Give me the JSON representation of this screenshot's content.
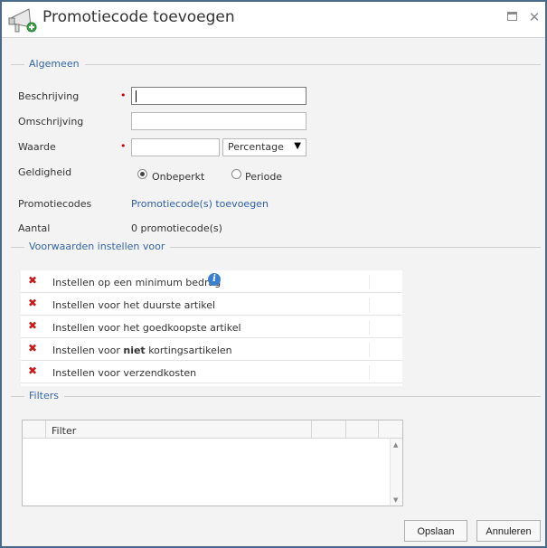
{
  "window": {
    "title": "Promotiecode toevoegen",
    "maximize_icon": "maximize-icon",
    "close_icon": "close-icon",
    "close_glyph": "✕"
  },
  "sections": {
    "general": "Algemeen",
    "conditions": "Voorwaarden instellen voor",
    "filters": "Filters"
  },
  "form": {
    "description_label": "Beschrijving",
    "description_value": "",
    "summary_label": "Omschrijving",
    "summary_value": "",
    "value_label": "Waarde",
    "value_value": "",
    "required_marker": "•",
    "value_type_selected": "Percentage",
    "validity_label": "Geldigheid",
    "validity_options": [
      "Onbeperkt",
      "Periode"
    ],
    "validity_selected": "Onbeperkt",
    "promocodes_label": "Promotiecodes",
    "promocodes_link": "Promotiecode(s) toevoegen",
    "count_label": "Aantal",
    "count_value": "0 promotiecode(s)"
  },
  "conditions": [
    {
      "pre": "Instellen op een minimum bedrag",
      "bold": "",
      "post": "",
      "info": true
    },
    {
      "pre": "Instellen voor het duurste artikel",
      "bold": "",
      "post": "",
      "info": false
    },
    {
      "pre": "Instellen voor het goedkoopste artikel",
      "bold": "",
      "post": "",
      "info": false
    },
    {
      "pre": "Instellen voor ",
      "bold": "niet",
      "post": " kortingsartikelen",
      "info": false
    },
    {
      "pre": "Instellen voor verzendkosten",
      "bold": "",
      "post": "",
      "info": false
    }
  ],
  "condition_status_icon": "red-x-icon",
  "filters_table": {
    "columns": [
      "Filter"
    ],
    "rows": []
  },
  "buttons": {
    "save": "Opslaan",
    "cancel": "Annuleren"
  },
  "colors": {
    "accent": "#3366aa",
    "required": "#cc0000",
    "remove": "#cc1a1a",
    "border": "#4a6a8a"
  }
}
